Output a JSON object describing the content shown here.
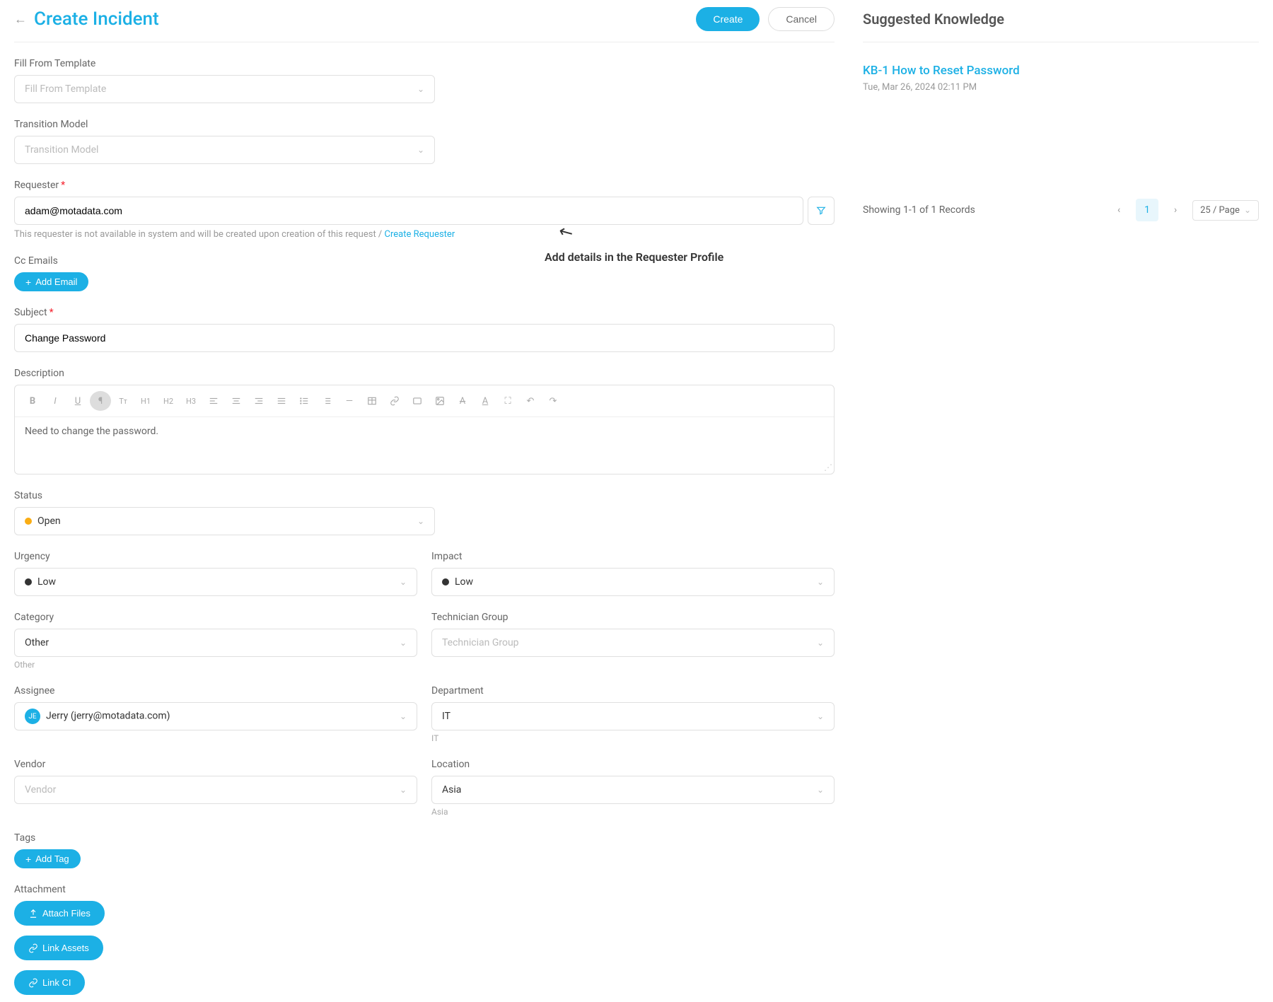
{
  "header": {
    "title": "Create Incident",
    "create": "Create",
    "cancel": "Cancel"
  },
  "form": {
    "template_label": "Fill From Template",
    "template_placeholder": "Fill From Template",
    "transition_label": "Transition Model",
    "transition_placeholder": "Transition Model",
    "requester_label": "Requester",
    "requester_value": "adam@motadata.com",
    "requester_hint": "This requester is not available in system and will be created upon creation of this request / ",
    "requester_link": "Create Requester",
    "cc_label": "Cc Emails",
    "cc_button": "Add Email",
    "subject_label": "Subject",
    "subject_value": "Change Password",
    "description_label": "Description",
    "description_value": "Need to change the password.",
    "status_label": "Status",
    "status_value": "Open",
    "urgency_label": "Urgency",
    "urgency_value": "Low",
    "impact_label": "Impact",
    "impact_value": "Low",
    "category_label": "Category",
    "category_value": "Other",
    "category_sub": "Other",
    "tech_group_label": "Technician Group",
    "tech_group_placeholder": "Technician Group",
    "assignee_label": "Assignee",
    "assignee_initials": "JE",
    "assignee_value": "Jerry (jerry@motadata.com)",
    "department_label": "Department",
    "department_value": "IT",
    "department_sub": "IT",
    "vendor_label": "Vendor",
    "vendor_placeholder": "Vendor",
    "location_label": "Location",
    "location_value": "Asia",
    "location_sub": "Asia",
    "tags_label": "Tags",
    "tags_button": "Add Tag",
    "attachment_label": "Attachment",
    "attach_button": "Attach Files",
    "link_assets_button": "Link Assets",
    "link_ci_button": "Link CI"
  },
  "toolbar": {
    "h1": "H1",
    "h2": "H2",
    "h3": "H3"
  },
  "annotation": {
    "text": "Add details in the Requester Profile"
  },
  "kb": {
    "title": "Suggested Knowledge",
    "item_title": "KB-1 How to Reset Password",
    "item_date": "Tue, Mar 26, 2024 02:11 PM",
    "showing": "Showing 1-1 of 1 Records",
    "page": "1",
    "page_size": "25 / Page"
  }
}
